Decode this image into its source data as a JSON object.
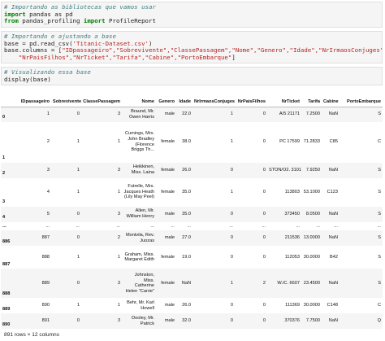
{
  "cell1": {
    "comment": "# Importando as bibliotecas que vamos usar",
    "l2_kw": "import",
    "l2_rest": " pandas as pd",
    "l3_kw1": "from",
    "l3_mid": " pandas_profiling ",
    "l3_kw2": "import",
    "l3_rest": " ProfileReport"
  },
  "cell2": {
    "comment": "# Importando e ajustando a base",
    "l2_pre": "base = pd.read_csv(",
    "l2_str": "'Titanic-Dataset.csv'",
    "l2_post": ")",
    "l3_pre": "base.columns = [",
    "l3_strs": "\"IDpassageiro\",\"Sobrevivente\",\"ClassePassagem\",\"Nome\",\"Genero\",\"Idade\",\"NrIrmaosConjuges\",",
    "l3_post": "\\",
    "l4_pre": "    ",
    "l4_strs": "\"NrPaisFilhos\",\"NrTicket\",\"Tarifa\",\"Cabine\",\"PortoEmbarque\"",
    "l4_post": "]"
  },
  "cell3": {
    "comment": "# Visualizando essa base",
    "line2": "display(base)"
  },
  "table": {
    "columns": [
      "",
      "IDpassageiro",
      "Sobrevivente",
      "ClassePassagem",
      "Nome",
      "Genero",
      "Idade",
      "NrIrmaosConjuges",
      "NrPaisFilhos",
      "NrTicket",
      "Tarifa",
      "Cabine",
      "PortoEmbarque"
    ],
    "rows": [
      [
        "0",
        "1",
        "0",
        "3",
        "Braund, Mr. Owen Harris",
        "male",
        "22.0",
        "1",
        "0",
        "A/5 21171",
        "7.2500",
        "NaN",
        "S"
      ],
      [
        "1",
        "2",
        "1",
        "1",
        "Cumings, Mrs. John Bradley (Florence Briggs Th...",
        "female",
        "38.0",
        "1",
        "0",
        "PC 17599",
        "71.2833",
        "C85",
        "C"
      ],
      [
        "2",
        "3",
        "1",
        "3",
        "Heikkinen, Miss. Laina",
        "female",
        "26.0",
        "0",
        "0",
        "STON/O2. 3101282",
        "7.9250",
        "NaN",
        "S"
      ],
      [
        "3",
        "4",
        "1",
        "1",
        "Futrelle, Mrs. Jacques Heath (Lily May Peel)",
        "female",
        "35.0",
        "1",
        "0",
        "113803",
        "53.1000",
        "C123",
        "S"
      ],
      [
        "4",
        "5",
        "0",
        "3",
        "Allen, Mr. William Henry",
        "male",
        "35.0",
        "0",
        "0",
        "373450",
        "8.0500",
        "NaN",
        "S"
      ],
      [
        "...",
        "...",
        "...",
        "...",
        "...",
        "...",
        "...",
        "...",
        "...",
        "...",
        "...",
        "...",
        "..."
      ],
      [
        "886",
        "887",
        "0",
        "2",
        "Montvila, Rev. Juozas",
        "male",
        "27.0",
        "0",
        "0",
        "211536",
        "13.0000",
        "NaN",
        "S"
      ],
      [
        "887",
        "888",
        "1",
        "1",
        "Graham, Miss. Margaret Edith",
        "female",
        "19.0",
        "0",
        "0",
        "112053",
        "30.0000",
        "B42",
        "S"
      ],
      [
        "888",
        "889",
        "0",
        "3",
        "Johnston, Miss. Catherine Helen \"Carrie\"",
        "female",
        "NaN",
        "1",
        "2",
        "W./C. 6607",
        "23.4500",
        "NaN",
        "S"
      ],
      [
        "889",
        "890",
        "1",
        "1",
        "Behr, Mr. Karl Howell",
        "male",
        "26.0",
        "0",
        "0",
        "111369",
        "30.0000",
        "C148",
        "C"
      ],
      [
        "890",
        "891",
        "0",
        "3",
        "Dooley, Mr. Patrick",
        "male",
        "32.0",
        "0",
        "0",
        "370376",
        "7.7500",
        "NaN",
        "Q"
      ]
    ],
    "footer": "891 rows × 12 columns"
  }
}
